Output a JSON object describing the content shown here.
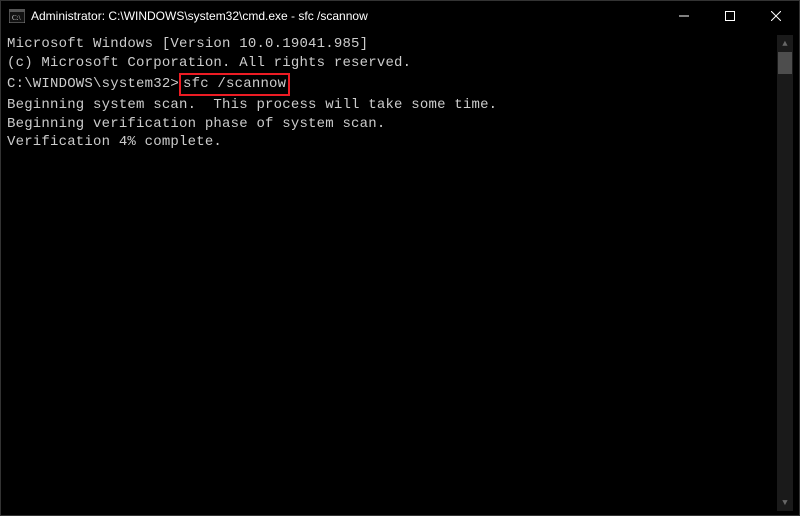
{
  "titlebar": {
    "title": "Administrator: C:\\WINDOWS\\system32\\cmd.exe - sfc  /scannow"
  },
  "terminal": {
    "line1": "Microsoft Windows [Version 10.0.19041.985]",
    "line2": "(c) Microsoft Corporation. All rights reserved.",
    "blank1": "",
    "promptPrefix": "C:\\WINDOWS\\system32>",
    "command": "sfc /scannow",
    "blank2": "",
    "scan1": "Beginning system scan.  This process will take some time.",
    "blank3": "",
    "verify1": "Beginning verification phase of system scan.",
    "verify2": "Verification 4% complete."
  },
  "colors": {
    "highlightBorder": "#ed1c24"
  }
}
